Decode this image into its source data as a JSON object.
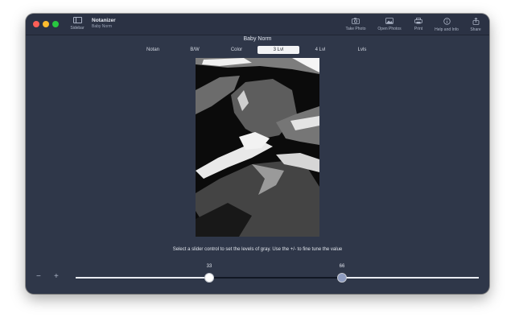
{
  "window": {
    "app_title": "Notanizer",
    "app_subtitle": "Baby Norm",
    "sidebar_label": "Sidebar"
  },
  "toolbar": {
    "items": [
      {
        "label": "Take Photo",
        "icon": "camera-icon"
      },
      {
        "label": "Open Photos",
        "icon": "photos-icon"
      },
      {
        "label": "Print",
        "icon": "printer-icon"
      },
      {
        "label": "Help and Info",
        "icon": "info-icon"
      },
      {
        "label": "Share",
        "icon": "share-icon"
      }
    ]
  },
  "document": {
    "title": "Baby Norm"
  },
  "modes": {
    "options": [
      "Notan",
      "B/W",
      "Color",
      "3 Lvl",
      "4 Lvl",
      "Lvls"
    ],
    "selected": "3 Lvl"
  },
  "instruction": "Select a slider control to set the levels of gray. Use the +/- to fine tune the value",
  "controls": {
    "minus": "−",
    "plus": "+"
  },
  "slider": {
    "min": 0,
    "max": 100,
    "level1": "33",
    "level2": "66"
  },
  "colors": {
    "window_bg": "#2f3749",
    "titlebar_bg": "#2b3244",
    "selected_segment_bg": "#f2f3f5",
    "slider_track_light": "#e9ecf2",
    "slider_track_dark": "#111723",
    "knob_2_fill": "#8e9cc0"
  }
}
